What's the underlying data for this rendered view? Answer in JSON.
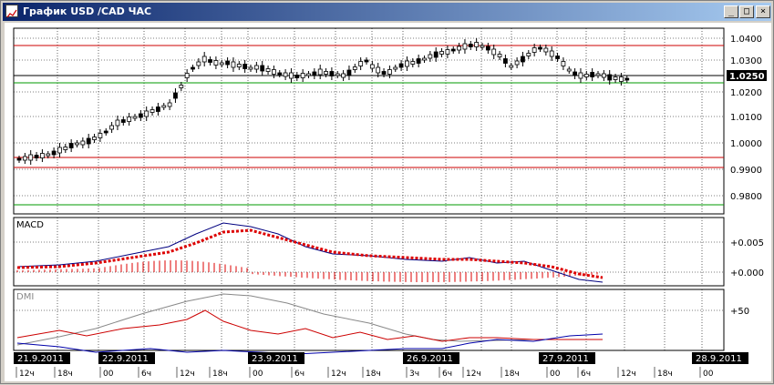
{
  "window": {
    "title": "График USD /CAD  ЧАС",
    "minimize_label": "_",
    "maximize_label": "□",
    "close_label": "×"
  },
  "price_panel": {
    "y_ticks": [
      "1.0400",
      "1.0300",
      "1.0200",
      "1.0100",
      "1.0000",
      "0.9900",
      "0.9800"
    ],
    "current_price": "1.0250"
  },
  "macd_panel": {
    "label": "MACD",
    "y_ticks": [
      "+0.005",
      "+0.000"
    ]
  },
  "dmi_panel": {
    "label": "DMI",
    "y_ticks": [
      "+50"
    ]
  },
  "time_axis": {
    "dates": [
      "21.9.2011",
      "22.9.2011",
      "23.9.2011",
      "26.9.2011",
      "27.9.2011",
      "28.9.2011"
    ],
    "hour_labels": [
      "12ч",
      "18ч",
      "00",
      "6ч",
      "12ч",
      "18ч",
      "00",
      "6ч",
      "12ч",
      "18ч",
      "3ч",
      "6ч",
      "12ч",
      "18ч",
      "00",
      "6ч",
      "12ч",
      "18ч",
      "00"
    ]
  },
  "colors": {
    "title_start": "#0a246a",
    "title_end": "#a6caf0",
    "resistance": "#cc0000",
    "support": "#009900",
    "macd_line": "#000080",
    "signal_line": "#dd0000",
    "dmi_adx": "#888888",
    "dmi_plus": "#cc0000",
    "dmi_minus": "#0000aa"
  }
}
